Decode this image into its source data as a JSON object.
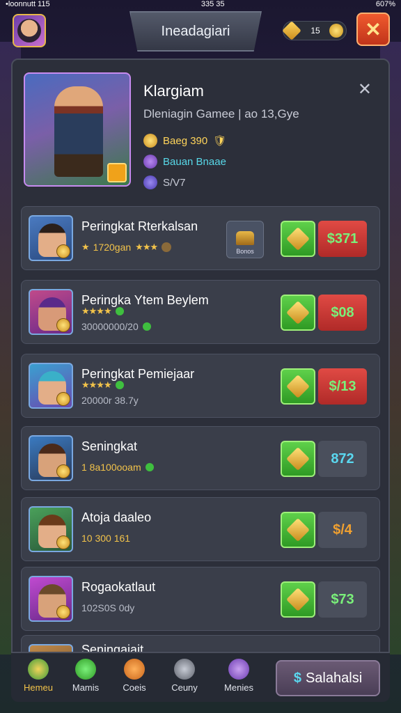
{
  "status_bar": {
    "left": "•loonnutt 115",
    "center": "335 35",
    "right": "607%"
  },
  "header": {
    "title": "Ineadagiari",
    "currency_value": "15"
  },
  "profile": {
    "name": "Klargiam",
    "subtitle": "Dleniagin Gamee | ao 13,Gye",
    "line1": "Baeg 390",
    "line2": "Bauan Bnaae",
    "line3": "S/V7"
  },
  "rows": [
    {
      "title": "Peringkat Rterkalsan",
      "meta": "1720gan",
      "meta_extra": "★★★",
      "chest_label": "Bonos",
      "price": "$371",
      "price_style": "red",
      "price_color": "#7af07a"
    },
    {
      "title": "Peringka Ytem Beylem",
      "stars": "★★★★",
      "meta": "30000000/20",
      "price": "$08",
      "price_style": "red",
      "price_color": "#7af07a"
    },
    {
      "title": "Peringkat Pemiejaar",
      "stars": "★★★★",
      "meta": "20000r 38.7y",
      "price": "$/13",
      "price_style": "red",
      "price_color": "#7af07a"
    },
    {
      "title": "Seningkat",
      "meta": "1 8a100ooam",
      "price": "872",
      "price_style": "dark",
      "price_color": "#5ad8f0"
    },
    {
      "title": "Atoja daaleo",
      "meta": "10 300 161",
      "price": "$/4",
      "price_style": "dark",
      "price_color": "#f0a030"
    },
    {
      "title": "Rogaokatlaut",
      "meta": "102S0S 0dy",
      "price": "$73",
      "price_style": "dark",
      "price_color": "#7af07a"
    },
    {
      "title": "Seningaiait"
    }
  ],
  "nav": [
    {
      "label": "Hemeu",
      "color": "#f2c34a"
    },
    {
      "label": "Mamis",
      "color": "#3fbf3f"
    },
    {
      "label": "Coeis",
      "color": "#f08a2a"
    },
    {
      "label": "Ceuny",
      "color": "#8a8e98"
    },
    {
      "label": "Menies",
      "color": "#9a6ad8"
    }
  ],
  "shop_button": {
    "label": "Salahalsi",
    "prefix": "$"
  },
  "colors": {
    "accent": "#f2c34a",
    "buy": "#3fbf3f",
    "close": "#e0502a"
  }
}
